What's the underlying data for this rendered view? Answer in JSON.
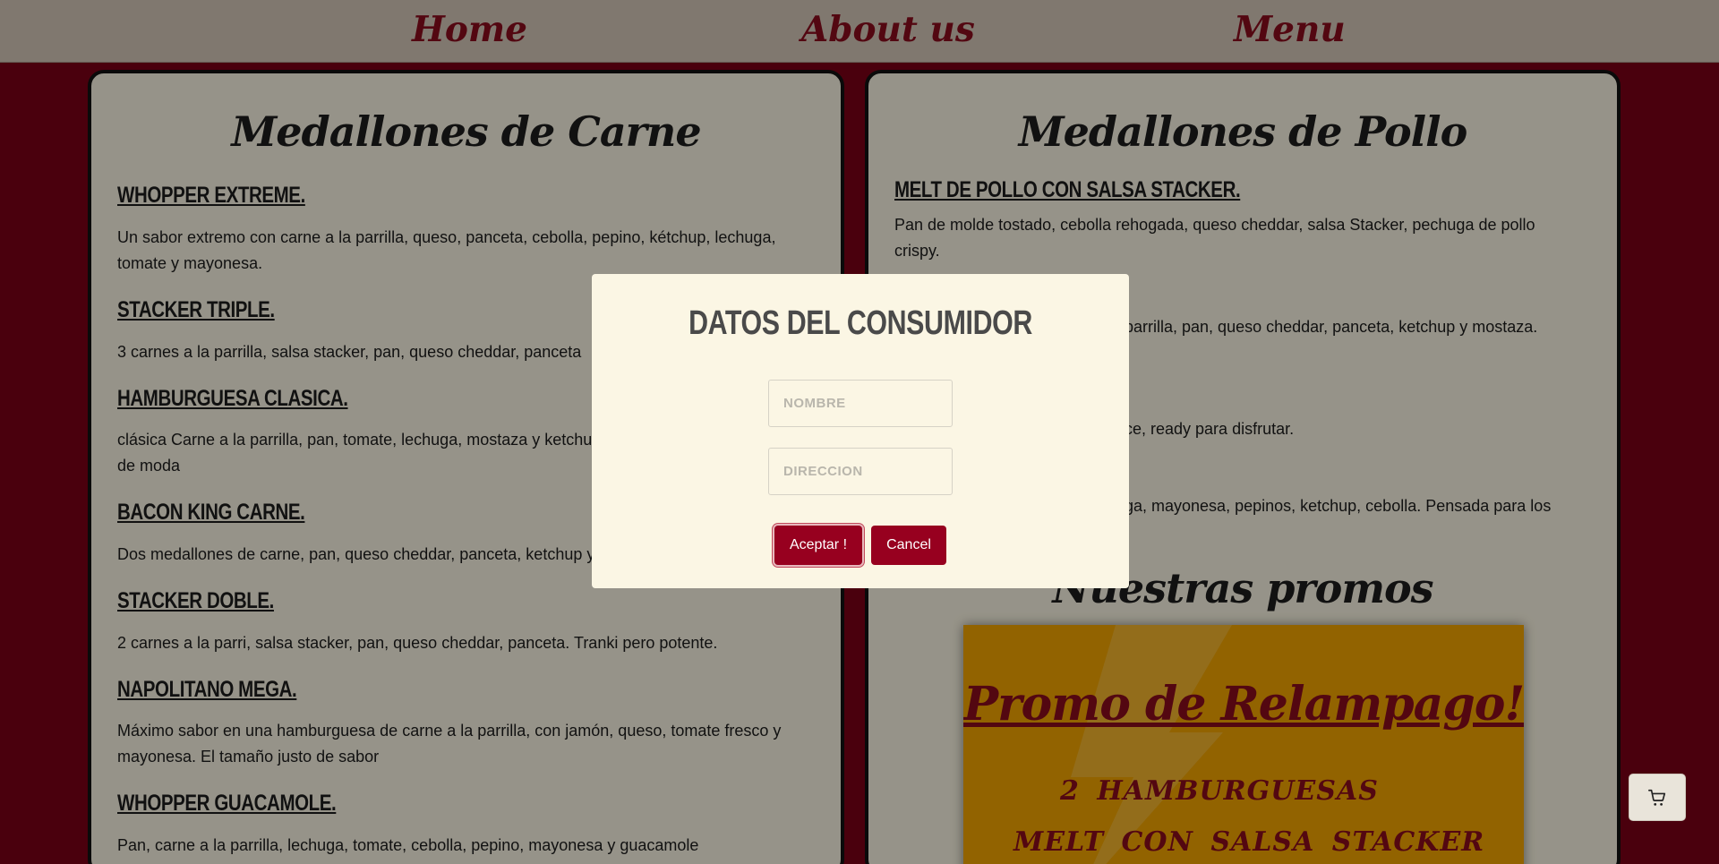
{
  "nav": {
    "home": "Home",
    "about": "About us",
    "menu": "Menu"
  },
  "carne": {
    "title": "Medallones de Carne",
    "items": [
      {
        "name": "WHOPPER EXTREME.",
        "desc": "Un sabor extremo con carne a la parrilla, queso, panceta, cebolla, pepino, kétchup, lechuga, tomate y mayonesa."
      },
      {
        "name": "STACKER TRIPLE.",
        "desc": "3 carnes a la parrilla, salsa stacker, pan, queso cheddar, panceta"
      },
      {
        "name": "HAMBURGUESA CLASICA.",
        "desc": "clásica Carne a la parrilla, pan, tomate, lechuga, mostaza y ketchup. Un clásico que nunca pasa de moda"
      },
      {
        "name": "BACON KING CARNE.",
        "desc": "Dos medallones de carne, pan, queso cheddar, panceta, ketchup y mayonesa."
      },
      {
        "name": "STACKER DOBLE.",
        "desc": "2 carnes a la parri, salsa stacker, pan, queso cheddar, panceta. Tranki pero potente."
      },
      {
        "name": "NAPOLITANO MEGA.",
        "desc": "Máximo sabor en una hamburguesa de carne a la parrilla, con jamón, queso, tomate fresco y mayonesa. El tamaño justo de sabor"
      },
      {
        "name": "WHOPPER GUACAMOLE.",
        "desc": "Pan, carne a la parrilla, lechuga, tomate, cebolla, pepino, mayonesa y guacamole"
      }
    ]
  },
  "pollo": {
    "title": "Medallones de Pollo",
    "items": [
      {
        "name": "MELT DE POLLO CON SALSA STACKER.",
        "desc": "Pan de molde tostado, cebolla rehogada, queso cheddar, salsa Stacker, pechuga de pollo crispy."
      },
      {
        "name": "",
        "desc": "parrilla, pan, queso cheddar, panceta, ketchup y mostaza."
      },
      {
        "name": "",
        "desc": "ce, ready para disfrutar."
      },
      {
        "name": "",
        "desc": "ga, mayonesa, pepinos, ketchup, cebolla. Pensada para los"
      }
    ]
  },
  "promos": {
    "title": "Nuestras promos",
    "card_title": "Promo de Relampago!",
    "line1": "2  HAMBURGUESAS",
    "line2": "MELT  CON  SALSA  STACKER",
    "card_color": "#f4a600"
  },
  "modal": {
    "title": "DATOS DEL CONSUMIDOR",
    "name_placeholder": "NOMBRE",
    "address_placeholder": "DIRECCION",
    "accept_label": "Aceptar !",
    "cancel_label": "Cancel"
  },
  "cart": {
    "icon": "cart-icon"
  },
  "colors": {
    "brand": "#8a0c1d",
    "background": "#7c0016",
    "panel": "#fbf6e4",
    "navbar": "#d5c9ba"
  }
}
